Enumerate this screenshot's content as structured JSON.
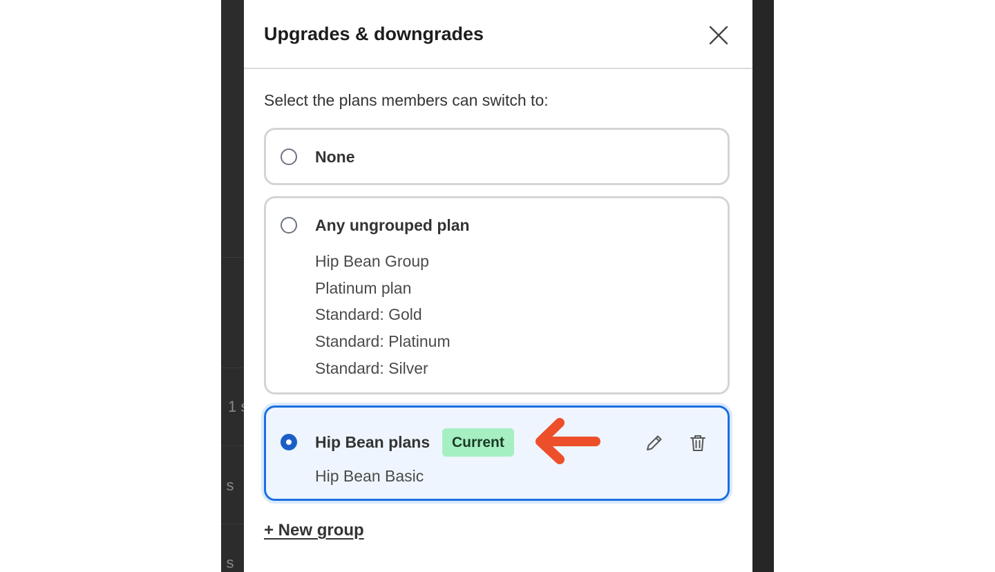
{
  "background": {
    "partial_row_1": "1 s",
    "partial_row_2": ") s",
    "partial_row_3": ") s"
  },
  "modal": {
    "title": "Upgrades & downgrades",
    "intro": "Select the plans members can switch to:",
    "options": [
      {
        "label": "None",
        "selected": false,
        "plans": []
      },
      {
        "label": "Any ungrouped plan",
        "selected": false,
        "plans": [
          "Hip Bean Group",
          "Platinum plan",
          "Standard: Gold",
          "Standard: Platinum",
          "Standard: Silver"
        ]
      },
      {
        "label": "Hip Bean plans",
        "selected": true,
        "badge": "Current",
        "plans": [
          "Hip Bean Basic"
        ]
      }
    ],
    "new_group_label": "+ New group"
  },
  "colors": {
    "accent": "#1a6fe0",
    "badge_bg": "#a5efc3",
    "annotation_arrow": "#ee4f2b"
  },
  "icons": {
    "close": "close-icon",
    "edit": "pencil-icon",
    "delete": "trash-icon",
    "annotation": "left-arrow-icon"
  }
}
